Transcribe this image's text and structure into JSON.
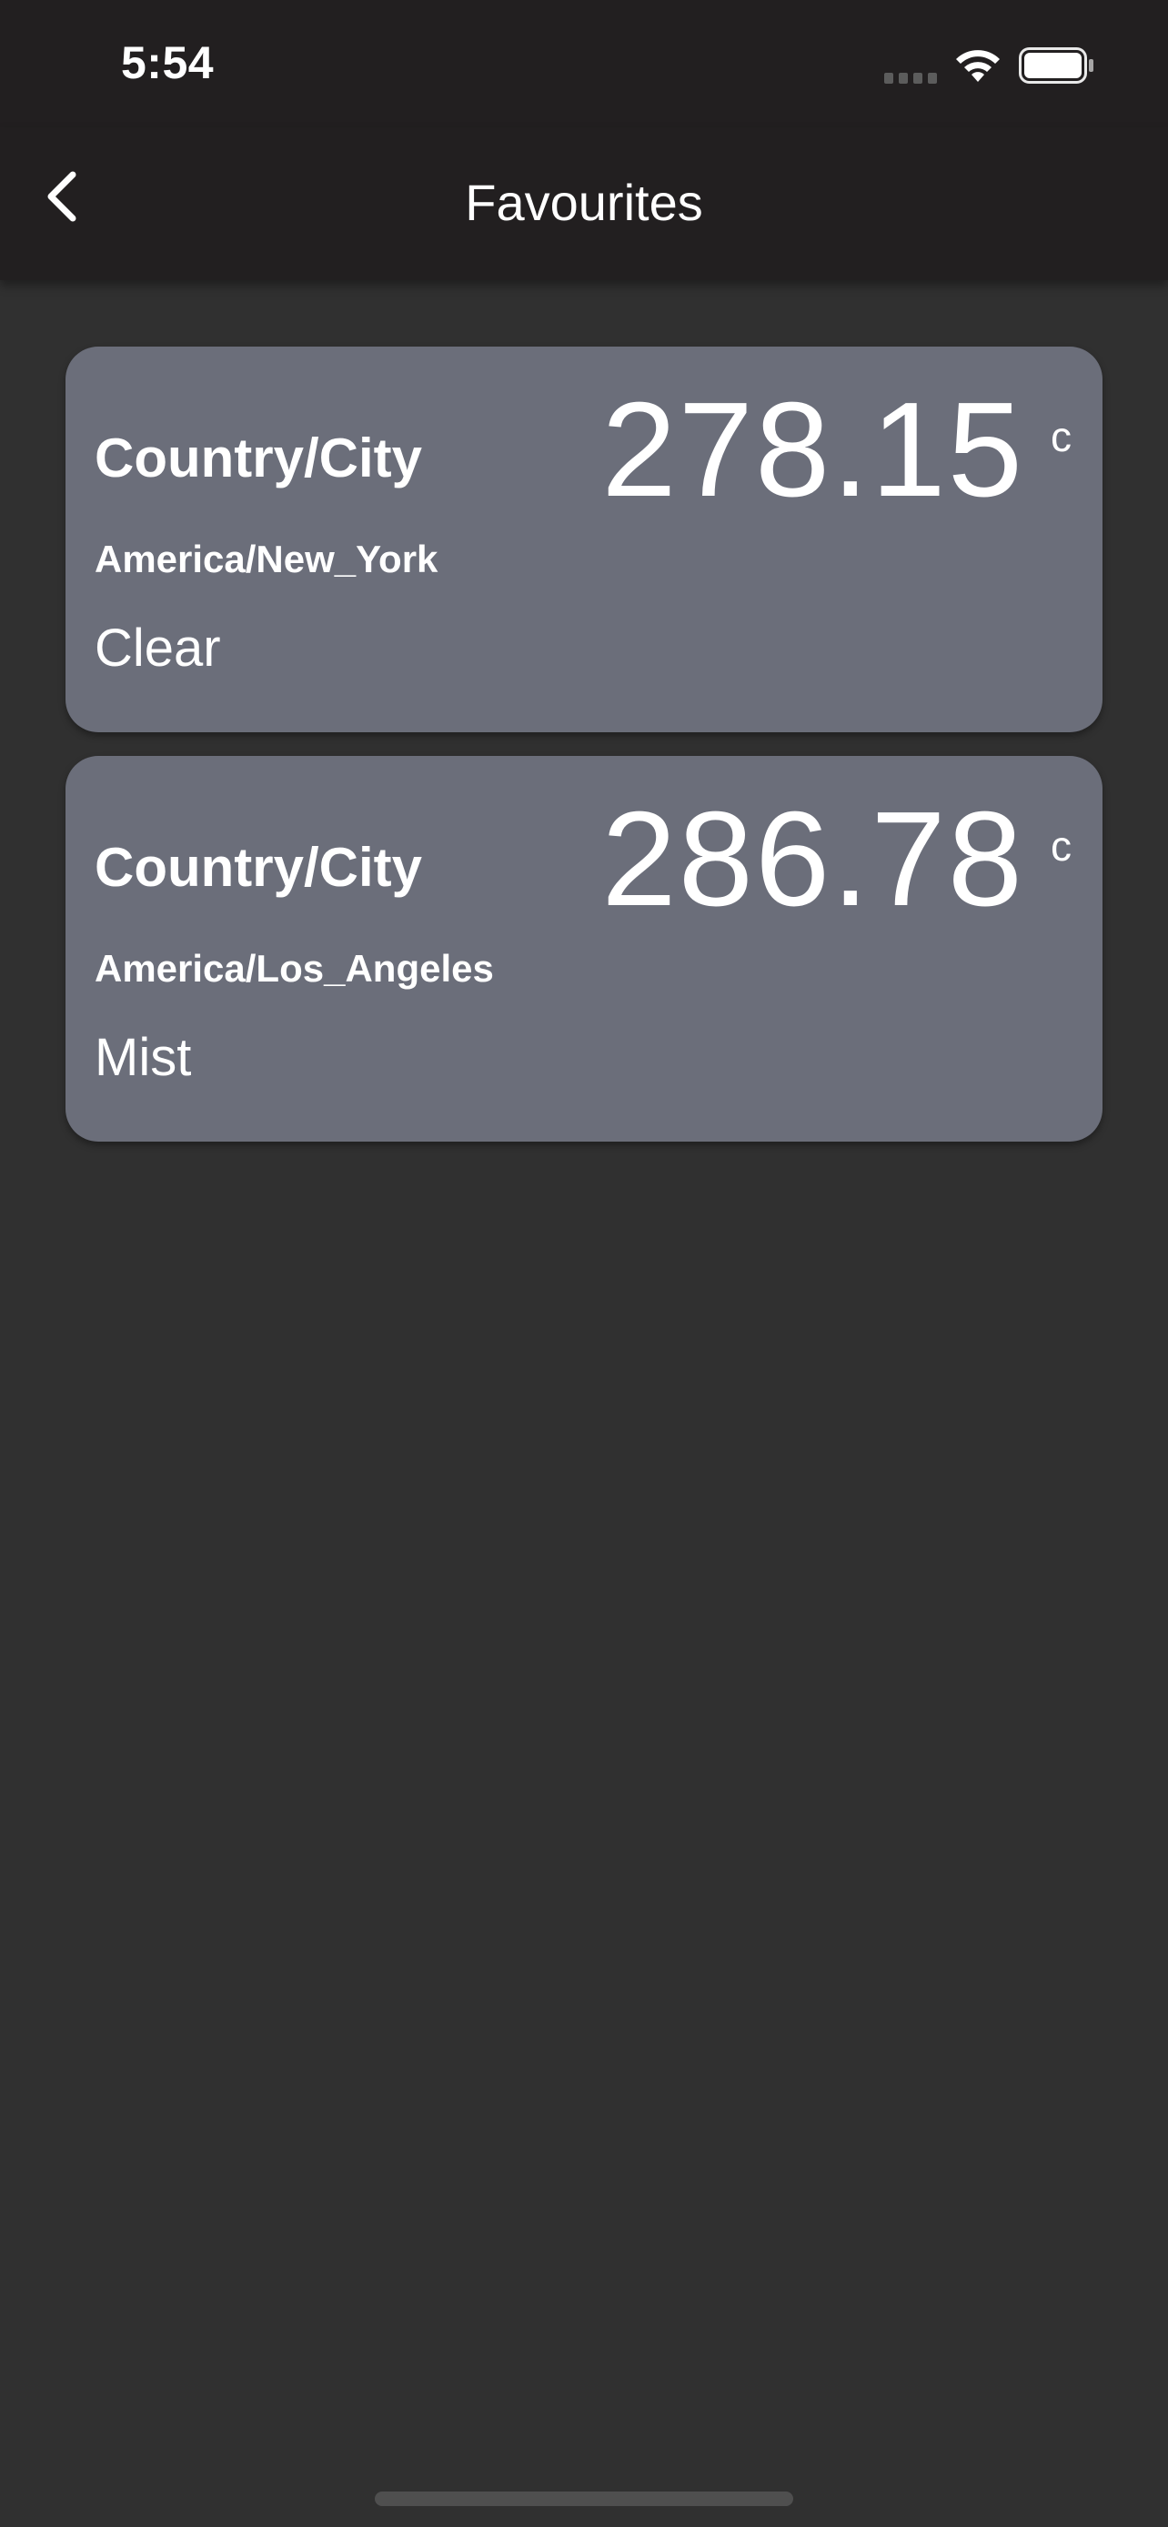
{
  "status_bar": {
    "time": "5:54"
  },
  "app_bar": {
    "title": "Favourites",
    "back_icon": "chevron-left-icon"
  },
  "favourites": [
    {
      "heading": "Country/City",
      "timezone": "America/New_York",
      "weather": "Clear",
      "temperature": "278.15",
      "unit": "c"
    },
    {
      "heading": "Country/City",
      "timezone": "America/Los_Angeles",
      "weather": "Mist",
      "temperature": "286.78",
      "unit": "c"
    }
  ],
  "colors": {
    "background": "#303030",
    "bar": "#221f20",
    "card": "#6b6e7a",
    "text": "#ffffff"
  }
}
